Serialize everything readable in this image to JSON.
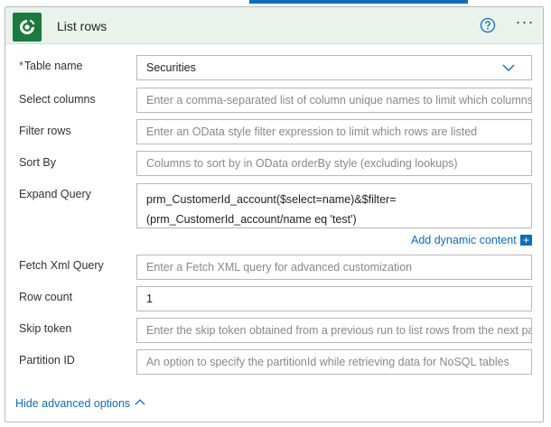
{
  "header": {
    "title": "List rows",
    "help_icon": "help-icon",
    "more_icon": "more-options-icon",
    "more_glyph": "···"
  },
  "fields": {
    "table_name": {
      "required_marker": "*",
      "label": "Table name",
      "value": "Securities"
    },
    "select_columns": {
      "label": "Select columns",
      "placeholder": "Enter a comma-separated list of column unique names to limit which columns are listed"
    },
    "filter_rows": {
      "label": "Filter rows",
      "placeholder": "Enter an OData style filter expression to limit which rows are listed"
    },
    "sort_by": {
      "label": "Sort By",
      "placeholder": "Columns to sort by in OData orderBy style (excluding lookups)"
    },
    "expand_query": {
      "label": "Expand Query",
      "value_line1": "prm_CustomerId_account($select=name)&$filter=",
      "value_line2": "(prm_CustomerId_account/name eq 'test')"
    },
    "fetch_xml": {
      "label": "Fetch Xml Query",
      "placeholder": "Enter a Fetch XML query for advanced customization"
    },
    "row_count": {
      "label": "Row count",
      "value": "1"
    },
    "skip_token": {
      "label": "Skip token",
      "placeholder": "Enter the skip token obtained from a previous run to list rows from the next page"
    },
    "partition_id": {
      "label": "Partition ID",
      "placeholder": "An option to specify the partitionId while retrieving data for NoSQL tables"
    }
  },
  "add_dynamic_content": {
    "label": "Add dynamic content",
    "icon": "plus-icon",
    "glyph": "+"
  },
  "hide_advanced": {
    "label": "Hide advanced options",
    "icon": "chevron-up-icon"
  },
  "colors": {
    "accent": "#0f6cbd",
    "header_bg": "#e9f3ec",
    "logo_bg": "#1c7a3f"
  }
}
